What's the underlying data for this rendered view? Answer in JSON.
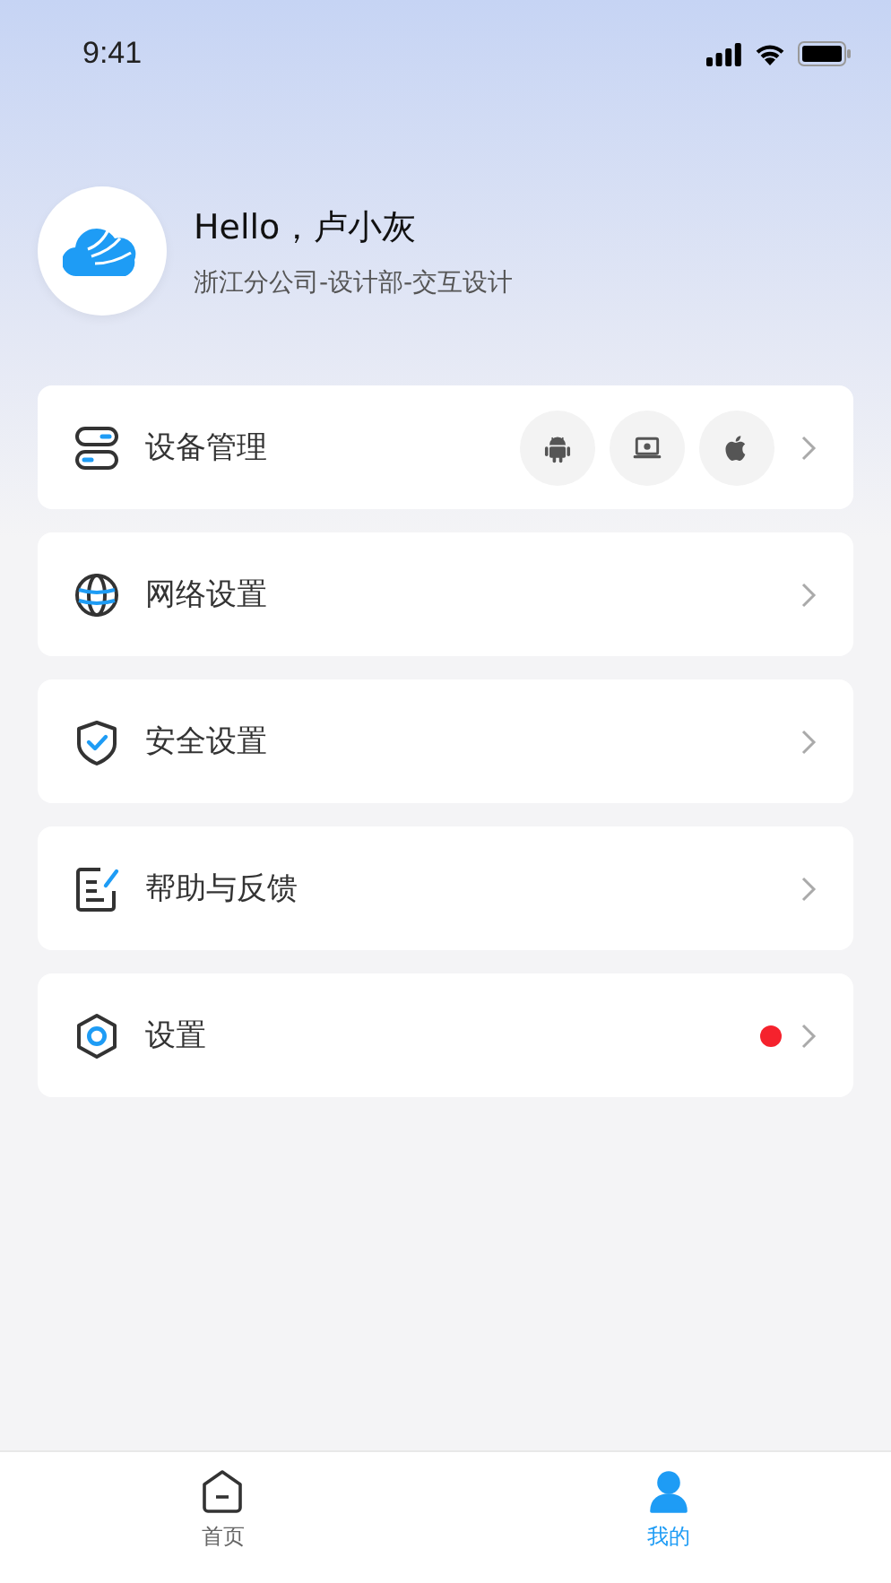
{
  "status_bar": {
    "time": "9:41"
  },
  "profile": {
    "greeting": "Hello，卢小灰",
    "department": "浙江分公司-设计部-交互设计"
  },
  "menu": [
    {
      "kind": "devices",
      "label": "设备管理",
      "dot": false
    },
    {
      "kind": "network",
      "label": "网络设置",
      "dot": false
    },
    {
      "kind": "security",
      "label": "安全设置",
      "dot": false
    },
    {
      "kind": "help",
      "label": "帮助与反馈",
      "dot": false
    },
    {
      "kind": "settings",
      "label": "设置",
      "dot": true
    }
  ],
  "tab_bar": [
    {
      "kind": "home",
      "label": "首页",
      "selected": false
    },
    {
      "kind": "me",
      "label": "我的",
      "selected": true
    }
  ]
}
